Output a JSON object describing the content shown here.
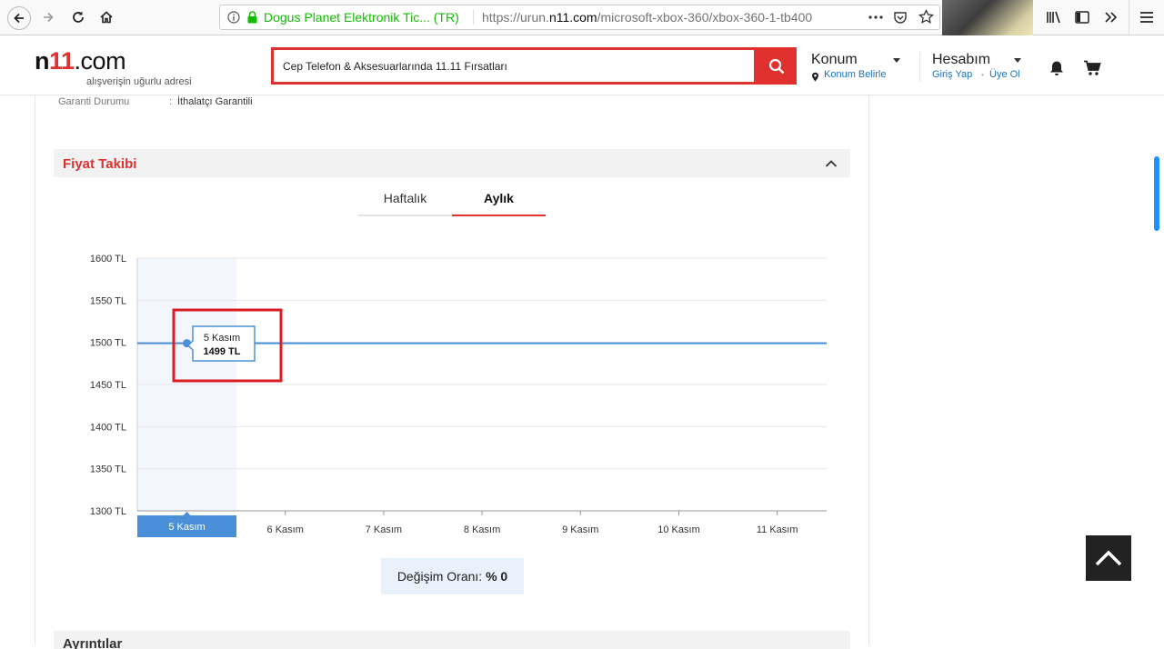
{
  "browser": {
    "site_identity": "Dogus Planet Elektronik Tic... (TR)",
    "url_prefix": "https://urun.",
    "url_domain": "n11.com",
    "url_path": "/microsoft-xbox-360/xbox-360-1-tb400"
  },
  "header": {
    "logo_n": "n",
    "logo_eleven": "11",
    "logo_dotcom": ".com",
    "logo_tagline": "alışverişin uğurlu adresi",
    "search_value": "Cep Telefon & Aksesuarlarında 11.11 Fırsatları",
    "konum_title": "Konum",
    "konum_sub": "Konum Belirle",
    "hesabim_title": "Hesabım",
    "giris_yap": "Giriş Yap",
    "uye_ol": "Üye Ol",
    "dot": "•"
  },
  "product": {
    "garanti_label": "Garanti Durumu",
    "garanti_colon": ":",
    "garanti_value": "İthalatçı Garantili"
  },
  "fiyat_takibi": {
    "title": "Fiyat Takibi",
    "tabs": [
      {
        "label": "Haftalık",
        "active": false
      },
      {
        "label": "Aylık",
        "active": true
      }
    ],
    "tooltip_date": "5 Kasım",
    "tooltip_price": "1499 TL",
    "degisim_label": "Değişim Oranı:",
    "degisim_value": "% 0"
  },
  "next_section": {
    "title": "Ayrıntılar"
  },
  "colors": {
    "brand_red": "#e0312f",
    "line_blue": "#4a90d9",
    "link_blue": "#1e73be"
  },
  "icons": [
    "back-arrow-icon",
    "forward-arrow-icon",
    "reload-icon",
    "home-icon",
    "info-icon",
    "lock-icon",
    "more-dots-icon",
    "pocket-icon",
    "star-icon",
    "library-icon",
    "sidebar-icon",
    "overflow-icon",
    "menu-icon",
    "search-icon",
    "location-pin-icon",
    "bell-icon",
    "cart-icon",
    "chevron-up-icon"
  ],
  "chart_data": {
    "type": "line",
    "categories": [
      "5 Kasım",
      "6 Kasım",
      "7 Kasım",
      "8 Kasım",
      "9 Kasım",
      "10 Kasım",
      "11 Kasım"
    ],
    "series": [
      {
        "values": [
          1499,
          1499,
          1499,
          1499,
          1499,
          1499,
          1499
        ]
      }
    ],
    "y_ticks": [
      "1300 TL",
      "1350 TL",
      "1400 TL",
      "1450 TL",
      "1500 TL",
      "1550 TL",
      "1600 TL"
    ],
    "ylim": [
      1300,
      1600
    ],
    "highlighted_category": "5 Kasım",
    "grid": true
  }
}
